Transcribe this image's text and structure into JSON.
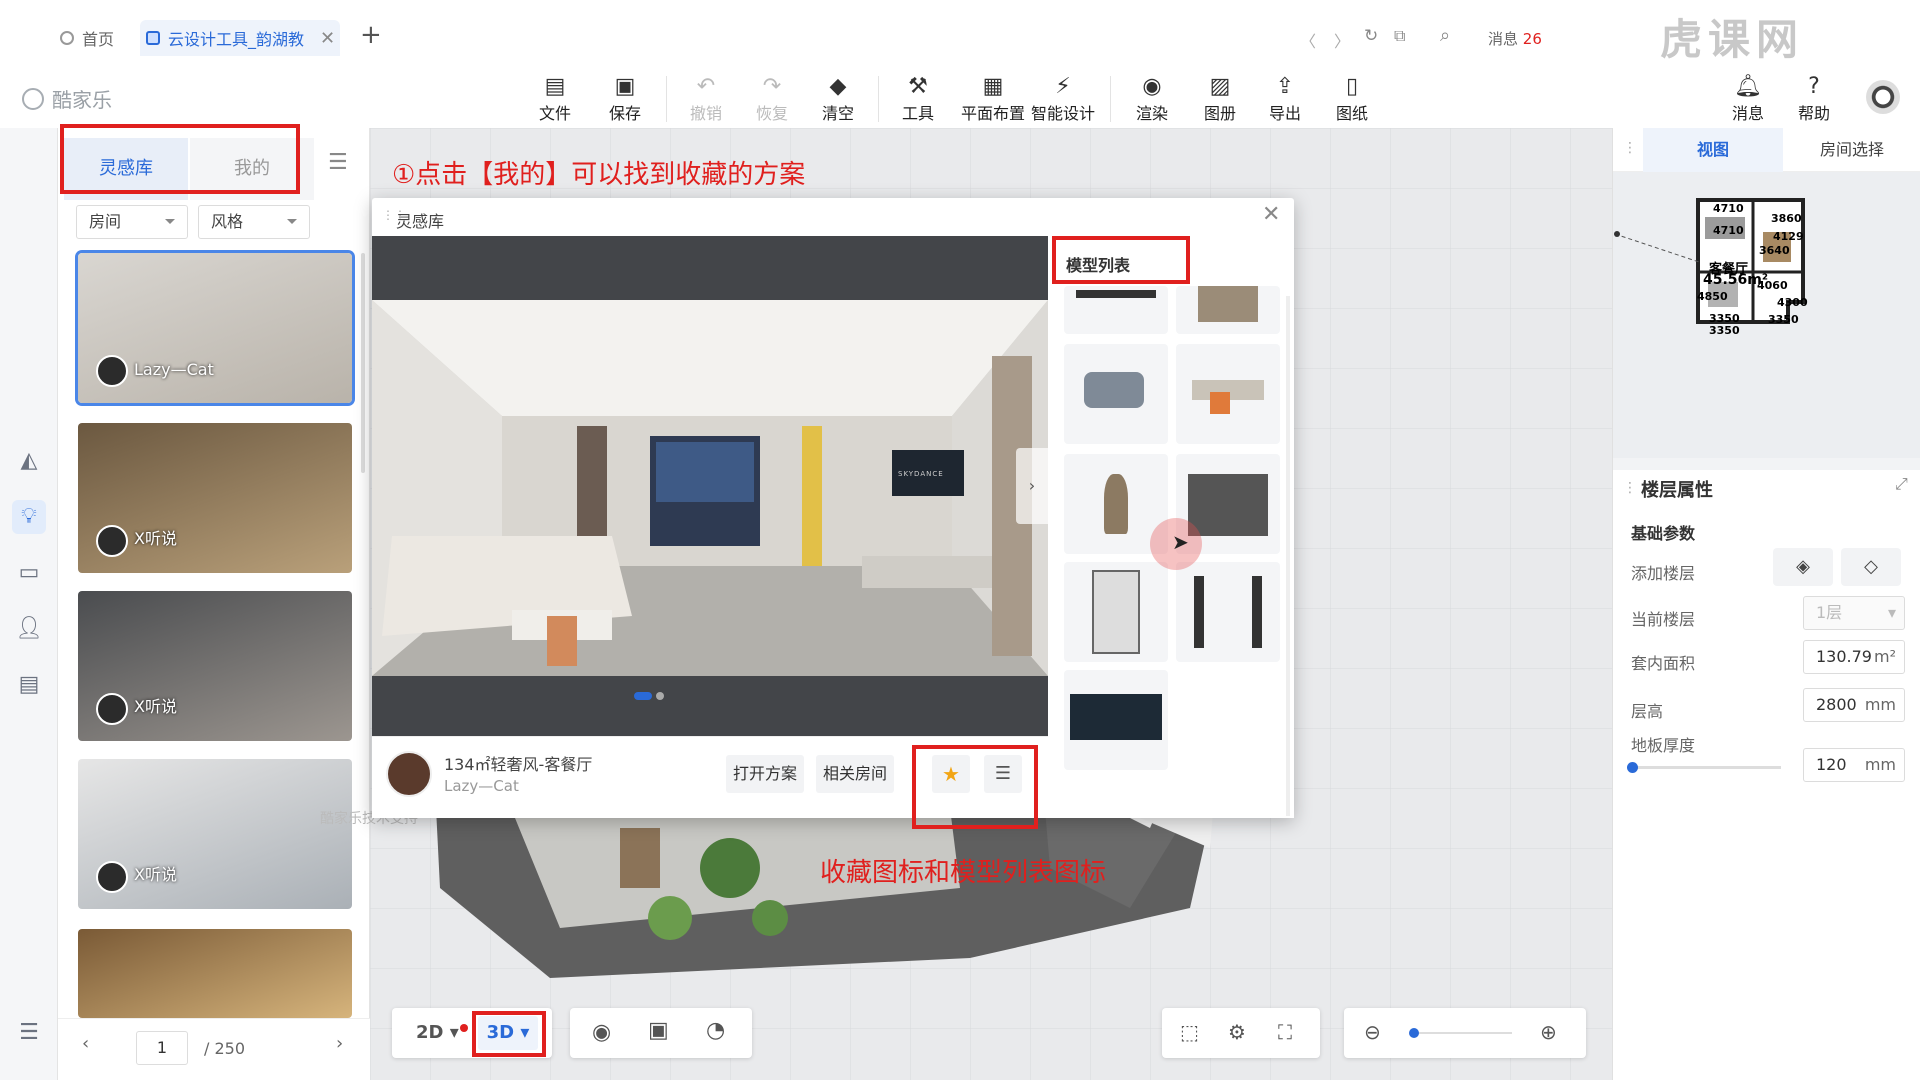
{
  "browser": {
    "tabs": [
      {
        "label": "首页"
      },
      {
        "label": "云设计工具_韵湖教"
      }
    ],
    "new_tab": "+",
    "messages_label": "消息",
    "messages_count": "26",
    "watermark": "虎课网"
  },
  "app": {
    "logo": "酷家乐"
  },
  "toolbar": {
    "items": [
      {
        "label": "文件",
        "icon": "file-icon"
      },
      {
        "label": "保存",
        "icon": "save-icon"
      },
      {
        "label": "撤销",
        "icon": "undo-icon"
      },
      {
        "label": "恢复",
        "icon": "redo-icon"
      },
      {
        "label": "清空",
        "icon": "eraser-icon"
      },
      {
        "label": "工具",
        "icon": "wrench-icon"
      },
      {
        "label": "平面布置",
        "icon": "layout-icon"
      },
      {
        "label": "智能设计",
        "icon": "lightning-icon"
      },
      {
        "label": "渲染",
        "icon": "camera-icon"
      },
      {
        "label": "图册",
        "icon": "image-icon"
      },
      {
        "label": "导出",
        "icon": "export-icon"
      },
      {
        "label": "图纸",
        "icon": "drawing-icon"
      }
    ],
    "right": [
      {
        "label": "消息",
        "icon": "bell-icon"
      },
      {
        "label": "帮助",
        "icon": "help-icon"
      }
    ]
  },
  "left_panel": {
    "tabs": [
      "灵感库",
      "我的"
    ],
    "filters": [
      "房间",
      "风格"
    ],
    "cards": [
      {
        "author": "Lazy—Cat",
        "colors": [
          "#d9d6d1",
          "#b9b3aa"
        ]
      },
      {
        "author": "X听说",
        "colors": [
          "#6b5840",
          "#b9a07a"
        ]
      },
      {
        "author": "X听说",
        "colors": [
          "#4a4c4f",
          "#9c9690"
        ]
      },
      {
        "author": "X听说",
        "colors": [
          "#e6e6e6",
          "#aab0b6"
        ]
      },
      {
        "author": "",
        "colors": [
          "#7a5a36",
          "#d6b47c"
        ]
      }
    ],
    "pagination": {
      "page": "1",
      "total": "/ 250"
    }
  },
  "annotations": {
    "step1": "①点击【我的】可以找到收藏的方案",
    "step2": "收藏图标和模型列表图标"
  },
  "modal": {
    "title": "灵感库",
    "model_list_title": "模型列表",
    "design_name": "134㎡轻奢风-客餐厅",
    "author": "Lazy—Cat",
    "open_button": "打开方案",
    "related_button": "相关房间",
    "tv_brand": "SKYDANCE"
  },
  "right_panel": {
    "tabs": [
      "视图",
      "房间选择"
    ],
    "floorplan_dims": [
      "4710",
      "4710",
      "3860",
      "3640",
      "4129",
      "4060",
      "3350",
      "3350",
      "3350",
      "4850",
      "4300"
    ],
    "area_label": "客餐厅",
    "area_value": "45.56m²",
    "section_title": "楼层属性",
    "sub_title": "基础参数",
    "props": [
      {
        "label": "添加楼层"
      },
      {
        "label": "当前楼层",
        "value": "1层"
      },
      {
        "label": "套内面积",
        "value": "130.79",
        "unit": "m²"
      },
      {
        "label": "层高",
        "value": "2800",
        "unit": "mm"
      },
      {
        "label": "地板厚度",
        "value": "120",
        "unit": "mm"
      }
    ]
  },
  "bottom_bar": {
    "view_2d": "2D",
    "view_3d": "3D",
    "support_text": "酷家乐技术支持"
  }
}
